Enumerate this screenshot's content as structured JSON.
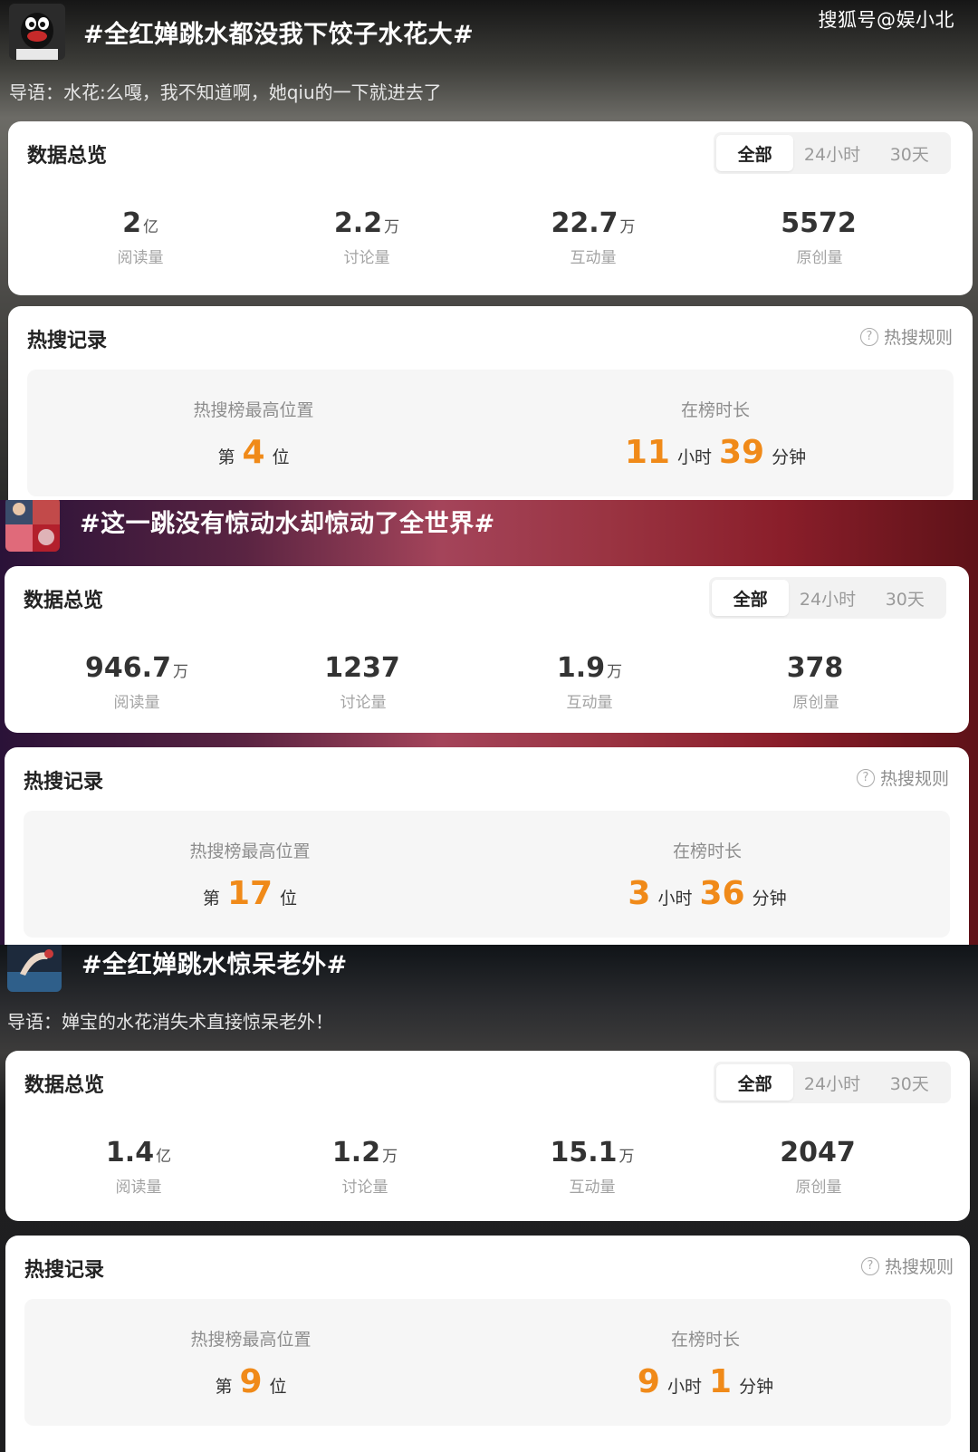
{
  "watermark": "搜狐号@娱小北",
  "topics": [
    {
      "title": "#全红婵跳水都没我下饺子水花大#",
      "guide": "导语：水花:么嘎，我不知道啊，她qiu的一下就进去了",
      "overview": {
        "title": "数据总览",
        "tabs": [
          "全部",
          "24小时",
          "30天"
        ],
        "active_tab": "全部",
        "stats": [
          {
            "value": "2",
            "unit": "亿",
            "label": "阅读量"
          },
          {
            "value": "2.2",
            "unit": "万",
            "label": "讨论量"
          },
          {
            "value": "22.7",
            "unit": "万",
            "label": "互动量"
          },
          {
            "value": "5572",
            "unit": "",
            "label": "原创量"
          }
        ]
      },
      "hot": {
        "title": "热搜记录",
        "rule_label": "热搜规则",
        "rank_title": "热搜榜最高位置",
        "rank_prefix": "第",
        "rank": "4",
        "rank_suffix": "位",
        "duration_title": "在榜时长",
        "hours": "11",
        "hours_unit": "小时",
        "minutes": "39",
        "minutes_unit": "分钟"
      }
    },
    {
      "title": "#这一跳没有惊动水却惊动了全世界#",
      "guide": "",
      "overview": {
        "title": "数据总览",
        "tabs": [
          "全部",
          "24小时",
          "30天"
        ],
        "active_tab": "全部",
        "stats": [
          {
            "value": "946.7",
            "unit": "万",
            "label": "阅读量"
          },
          {
            "value": "1237",
            "unit": "",
            "label": "讨论量"
          },
          {
            "value": "1.9",
            "unit": "万",
            "label": "互动量"
          },
          {
            "value": "378",
            "unit": "",
            "label": "原创量"
          }
        ]
      },
      "hot": {
        "title": "热搜记录",
        "rule_label": "热搜规则",
        "rank_title": "热搜榜最高位置",
        "rank_prefix": "第",
        "rank": "17",
        "rank_suffix": "位",
        "duration_title": "在榜时长",
        "hours": "3",
        "hours_unit": "小时",
        "minutes": "36",
        "minutes_unit": "分钟"
      }
    },
    {
      "title": "#全红婵跳水惊呆老外#",
      "guide": "导语：婵宝的水花消失术直接惊呆老外！",
      "overview": {
        "title": "数据总览",
        "tabs": [
          "全部",
          "24小时",
          "30天"
        ],
        "active_tab": "全部",
        "stats": [
          {
            "value": "1.4",
            "unit": "亿",
            "label": "阅读量"
          },
          {
            "value": "1.2",
            "unit": "万",
            "label": "讨论量"
          },
          {
            "value": "15.1",
            "unit": "万",
            "label": "互动量"
          },
          {
            "value": "2047",
            "unit": "",
            "label": "原创量"
          }
        ]
      },
      "hot": {
        "title": "热搜记录",
        "rule_label": "热搜规则",
        "rank_title": "热搜榜最高位置",
        "rank_prefix": "第",
        "rank": "9",
        "rank_suffix": "位",
        "duration_title": "在榜时长",
        "hours": "9",
        "hours_unit": "小时",
        "minutes": "1",
        "minutes_unit": "分钟"
      }
    }
  ]
}
